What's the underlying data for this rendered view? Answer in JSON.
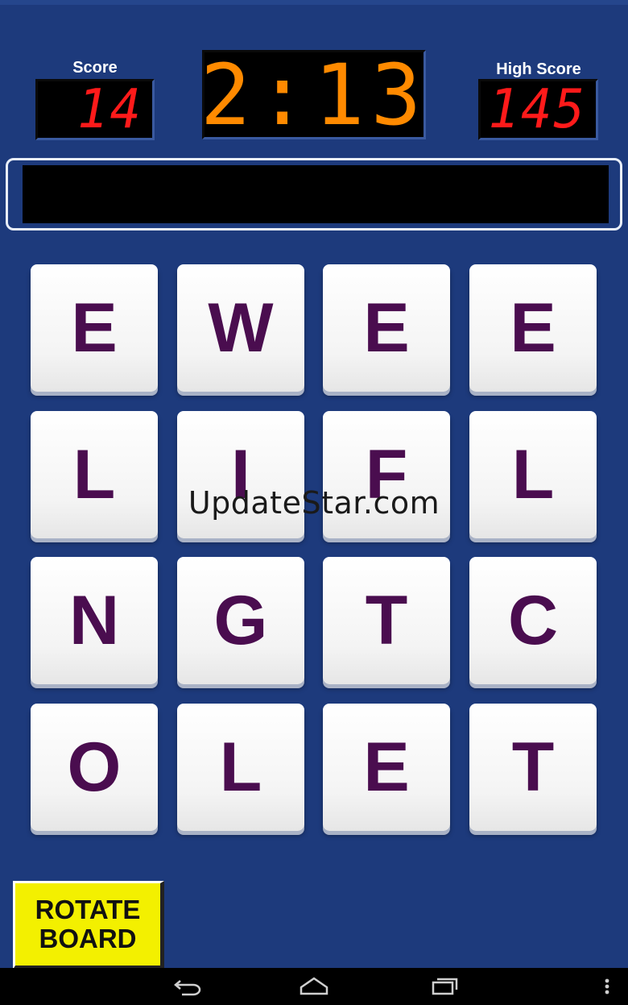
{
  "header": {
    "score_label": "Score",
    "score_value": "14",
    "timer_value": "2:13",
    "high_score_label": "High Score",
    "high_score_value": "145"
  },
  "current_word": "",
  "board": {
    "rows": [
      [
        "E",
        "W",
        "E",
        "E"
      ],
      [
        "L",
        "I",
        "F",
        "L"
      ],
      [
        "N",
        "G",
        "T",
        "C"
      ],
      [
        "O",
        "L",
        "E",
        "T"
      ]
    ]
  },
  "watermark": "UpdateStar.com",
  "rotate_button": {
    "line1": "ROTATE",
    "line2": "BOARD"
  },
  "navbar": {
    "icons": [
      "back-icon",
      "home-icon",
      "recent-apps-icon",
      "overflow-menu-icon"
    ]
  },
  "colors": {
    "background": "#1d3a7c",
    "tile_letter": "#4a0d4f",
    "score_digits": "#ff1a1a",
    "timer_digits": "#ff8a00",
    "rotate_button": "#f3f000"
  }
}
